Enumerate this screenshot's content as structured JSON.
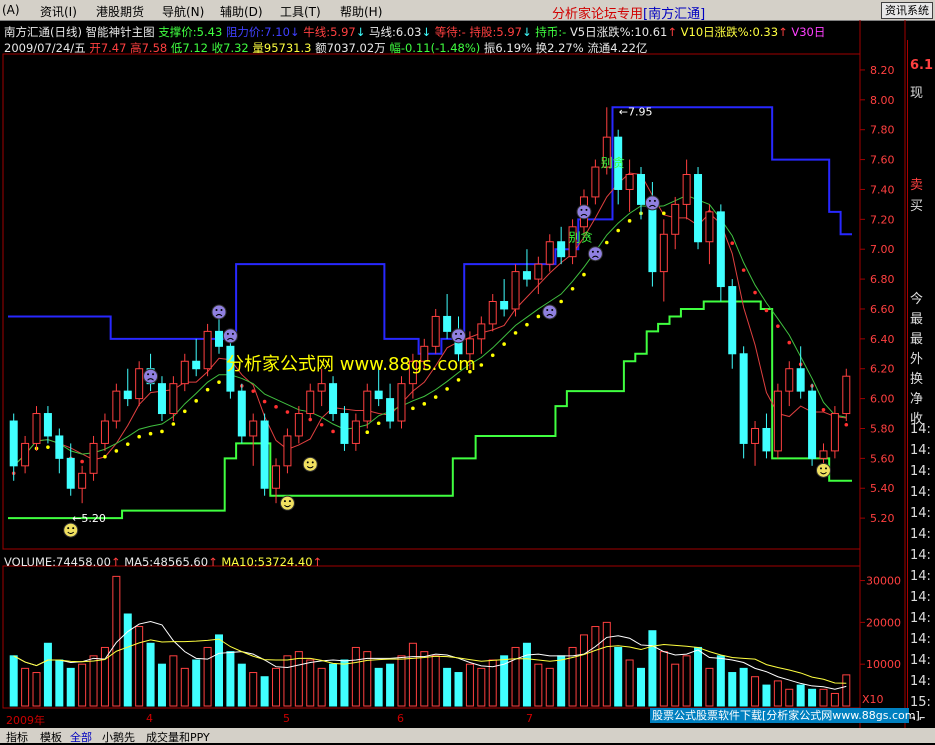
{
  "menu": {
    "items": [
      "(A)",
      "资讯(I)",
      "港股期货",
      "导航(N)",
      "辅助(D)",
      "工具(T)",
      "帮助(H)"
    ],
    "brand": "分析家论坛专用",
    "brand_badge": "[南方汇通]",
    "right_button": "资讯系统"
  },
  "title_line": {
    "stock": "南方汇通(日线)",
    "indicator": "智能神针主图",
    "support": "支撑价:5.43",
    "pressure": "阻力价:7.10",
    "niu": "牛线:5.97",
    "ma": "马线:6.03",
    "wait": "等待:-",
    "hold": "持股:5.97",
    "hold_coin": "持币:-",
    "v5": "V5日涨跌%:10.61",
    "v10": "V10日涨跌%:0.33",
    "v30": "V30日"
  },
  "info_line": {
    "date": "2009/07/24/五",
    "open": "开7.47",
    "high": "高7.58",
    "low": "低7.12",
    "close": "收7.32",
    "volume": "量95731.3",
    "amount": "额7037.02万",
    "change": "幅-0.11(-1.48%)",
    "amplitude": "振6.19%",
    "turnover": "换2.27%",
    "float": "流通4.22亿"
  },
  "price_axis": [
    "8.20",
    "8.00",
    "7.80",
    "7.60",
    "7.40",
    "7.20",
    "7.00",
    "6.80",
    "6.60",
    "6.40",
    "6.20",
    "6.00",
    "5.80",
    "5.60",
    "5.40",
    "5.20"
  ],
  "annotations": {
    "high": "7.95",
    "low": "5.20",
    "bie_tan_1": "别贪",
    "bie_tan_2": "别贪"
  },
  "watermark": "分析家公式网 www.88gs.com",
  "volume_line": {
    "volume": "VOLUME:74458.00",
    "ma5": "MA5:48565.60",
    "ma10": "MA10:53724.40"
  },
  "volume_axis": [
    "30000",
    "20000",
    "10000"
  ],
  "volume_axis_unit": "X10",
  "dates": [
    "2009年",
    "4",
    "5",
    "6",
    "7"
  ],
  "ad_text": "股票公式股票软件下载[分析家公式网www.88gs.com]",
  "bottom_tabs": [
    "指标",
    "模板",
    "全部",
    "小鹅先",
    "成交量和PPY"
  ],
  "right_panel": {
    "price": "6.1",
    "label_now": "现",
    "sell": "卖",
    "buy": "买",
    "stats": [
      "今",
      "最",
      "最",
      "外",
      "换",
      "净",
      "收"
    ],
    "times": [
      "14:",
      "14:",
      "14:",
      "14:",
      "14:",
      "14:",
      "14:",
      "14:",
      "14:",
      "14:",
      "14:",
      "14:",
      "14:",
      "15:",
      "15:"
    ]
  },
  "colors": {
    "bg": "#000000",
    "up": "#ff4040",
    "down": "#40ffff",
    "resistance": "#3030ff",
    "support": "#40ff40"
  },
  "chart_data": {
    "type": "candlestick",
    "ylim": [
      5.0,
      8.3
    ],
    "series": [
      {
        "name": "OHLC",
        "values": [
          [
            5.85,
            5.9,
            5.45,
            5.55
          ],
          [
            5.55,
            5.75,
            5.5,
            5.7
          ],
          [
            5.7,
            5.95,
            5.65,
            5.9
          ],
          [
            5.9,
            5.95,
            5.7,
            5.75
          ],
          [
            5.75,
            5.8,
            5.5,
            5.6
          ],
          [
            5.6,
            5.7,
            5.35,
            5.4
          ],
          [
            5.4,
            5.55,
            5.3,
            5.5
          ],
          [
            5.5,
            5.75,
            5.45,
            5.7
          ],
          [
            5.7,
            5.9,
            5.65,
            5.85
          ],
          [
            5.85,
            6.1,
            5.8,
            6.05
          ],
          [
            6.05,
            6.2,
            5.95,
            6.0
          ],
          [
            6.0,
            6.25,
            5.95,
            6.2
          ],
          [
            6.2,
            6.3,
            6.05,
            6.1
          ],
          [
            6.1,
            6.15,
            5.85,
            5.9
          ],
          [
            5.9,
            6.15,
            5.85,
            6.1
          ],
          [
            6.1,
            6.3,
            6.05,
            6.25
          ],
          [
            6.25,
            6.4,
            6.15,
            6.2
          ],
          [
            6.2,
            6.5,
            6.15,
            6.45
          ],
          [
            6.45,
            6.6,
            6.3,
            6.35
          ],
          [
            6.35,
            6.4,
            6.0,
            6.05
          ],
          [
            6.05,
            6.1,
            5.7,
            5.75
          ],
          [
            5.75,
            5.9,
            5.55,
            5.85
          ],
          [
            5.85,
            5.9,
            5.35,
            5.4
          ],
          [
            5.4,
            5.6,
            5.3,
            5.55
          ],
          [
            5.55,
            5.8,
            5.5,
            5.75
          ],
          [
            5.75,
            5.95,
            5.7,
            5.9
          ],
          [
            5.9,
            6.1,
            5.85,
            6.05
          ],
          [
            6.05,
            6.2,
            5.95,
            6.1
          ],
          [
            6.1,
            6.15,
            5.85,
            5.9
          ],
          [
            5.9,
            5.95,
            5.65,
            5.7
          ],
          [
            5.7,
            5.9,
            5.65,
            5.85
          ],
          [
            5.85,
            6.1,
            5.8,
            6.05
          ],
          [
            6.05,
            6.2,
            5.95,
            6.0
          ],
          [
            6.0,
            6.1,
            5.8,
            5.85
          ],
          [
            5.85,
            6.15,
            5.8,
            6.1
          ],
          [
            6.1,
            6.3,
            6.0,
            6.25
          ],
          [
            6.25,
            6.4,
            6.2,
            6.35
          ],
          [
            6.35,
            6.6,
            6.3,
            6.55
          ],
          [
            6.55,
            6.7,
            6.4,
            6.45
          ],
          [
            6.45,
            6.55,
            6.25,
            6.3
          ],
          [
            6.3,
            6.45,
            6.2,
            6.4
          ],
          [
            6.4,
            6.55,
            6.3,
            6.5
          ],
          [
            6.5,
            6.7,
            6.45,
            6.65
          ],
          [
            6.65,
            6.8,
            6.55,
            6.6
          ],
          [
            6.6,
            6.9,
            6.55,
            6.85
          ],
          [
            6.85,
            7.0,
            6.75,
            6.8
          ],
          [
            6.8,
            6.95,
            6.7,
            6.9
          ],
          [
            6.9,
            7.1,
            6.85,
            7.05
          ],
          [
            7.05,
            7.15,
            6.9,
            6.95
          ],
          [
            6.95,
            7.2,
            6.9,
            7.15
          ],
          [
            7.15,
            7.4,
            7.1,
            7.35
          ],
          [
            7.35,
            7.6,
            7.3,
            7.55
          ],
          [
            7.55,
            7.95,
            7.5,
            7.75
          ],
          [
            7.75,
            7.8,
            7.3,
            7.4
          ],
          [
            7.4,
            7.6,
            7.25,
            7.5
          ],
          [
            7.5,
            7.55,
            7.2,
            7.3
          ],
          [
            7.3,
            7.45,
            6.75,
            6.85
          ],
          [
            6.85,
            7.2,
            6.65,
            7.1
          ],
          [
            7.1,
            7.35,
            7.0,
            7.3
          ],
          [
            7.3,
            7.6,
            7.2,
            7.5
          ],
          [
            7.5,
            7.55,
            7.0,
            7.05
          ],
          [
            7.05,
            7.3,
            6.9,
            7.25
          ],
          [
            7.25,
            7.3,
            6.65,
            6.75
          ],
          [
            6.75,
            6.8,
            6.2,
            6.3
          ],
          [
            6.3,
            6.35,
            5.6,
            5.7
          ],
          [
            5.7,
            5.85,
            5.55,
            5.8
          ],
          [
            5.8,
            5.9,
            5.6,
            5.65
          ],
          [
            5.65,
            6.1,
            5.6,
            6.05
          ],
          [
            6.05,
            6.25,
            5.95,
            6.2
          ],
          [
            6.2,
            6.35,
            6.0,
            6.05
          ],
          [
            6.05,
            6.1,
            5.55,
            5.6
          ],
          [
            5.6,
            5.7,
            5.55,
            5.65
          ],
          [
            5.65,
            5.95,
            5.6,
            5.9
          ],
          [
            5.9,
            6.2,
            5.85,
            6.15
          ]
        ]
      },
      {
        "name": "VOLUME",
        "values": [
          12000,
          9000,
          8000,
          15000,
          11000,
          9000,
          10000,
          12000,
          14000,
          31000,
          22000,
          19000,
          15000,
          10000,
          12000,
          9000,
          11000,
          14000,
          17000,
          13000,
          10000,
          8000,
          7000,
          9000,
          12000,
          13000,
          11000,
          9000,
          10000,
          11000,
          14000,
          13000,
          9000,
          10000,
          12000,
          15000,
          13000,
          12000,
          9000,
          8000,
          10000,
          9000,
          11000,
          12000,
          14000,
          15000,
          10000,
          9000,
          12000,
          14000,
          17000,
          19000,
          20000,
          14000,
          11000,
          9000,
          18000,
          13000,
          10000,
          12000,
          14000,
          9000,
          12000,
          8000,
          9000,
          7000,
          5000,
          6000,
          4000,
          5000,
          4000,
          4000,
          3000,
          7445
        ]
      }
    ]
  }
}
